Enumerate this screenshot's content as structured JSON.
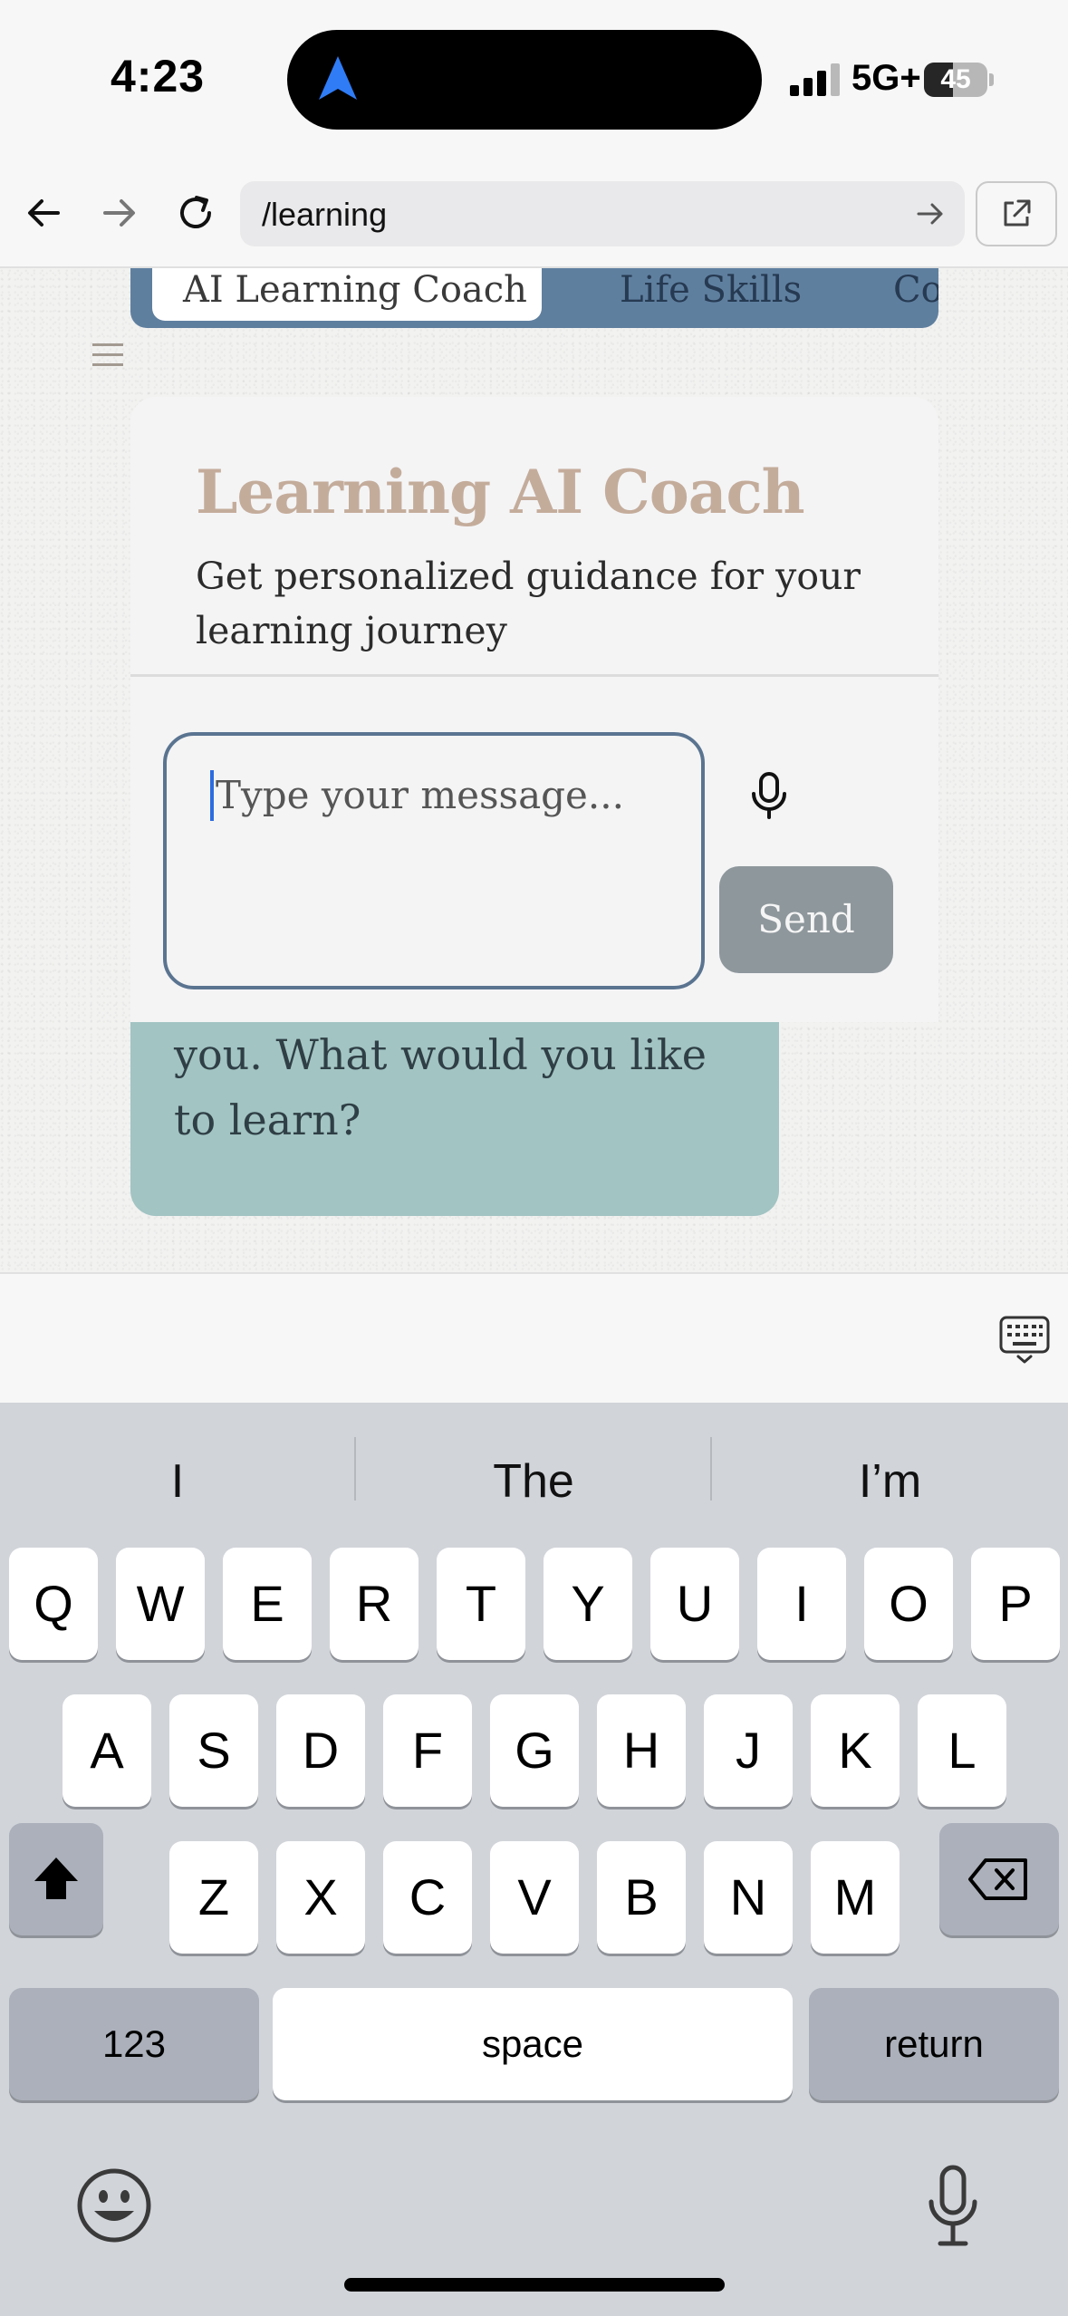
{
  "status_bar": {
    "time": "4:23",
    "network": "5G+",
    "battery": "45",
    "battery_level_percent": 45
  },
  "browser": {
    "url": "/learning",
    "icons": {
      "back": "back-arrow-icon",
      "forward": "forward-arrow-icon",
      "reload": "reload-icon",
      "go": "go-arrow-icon",
      "open_external": "open-external-icon"
    }
  },
  "page": {
    "tabs": [
      {
        "label": "AI Learning Coach",
        "selected": true
      },
      {
        "label": "Life Skills",
        "selected": false
      },
      {
        "label": "Co",
        "selected": false
      }
    ],
    "coach": {
      "title": "Learning AI Coach",
      "subtitle": "Get personalized guidance for your learning journey",
      "input_placeholder": "Type your message...",
      "send_label": "Send"
    },
    "chat_bubble_text": "you. What would you like to learn?",
    "colors": {
      "tab_strip": "#5f7f9f",
      "title": "#c4ac9b",
      "send_button": "#8e979c",
      "bubble": "#a2c4c3",
      "input_border": "#5a7490"
    }
  },
  "keyboard": {
    "suggestions": [
      "I",
      "The",
      "I’m"
    ],
    "row1": [
      "Q",
      "W",
      "E",
      "R",
      "T",
      "Y",
      "U",
      "I",
      "O",
      "P"
    ],
    "row2": [
      "A",
      "S",
      "D",
      "F",
      "G",
      "H",
      "J",
      "K",
      "L"
    ],
    "row3": [
      "Z",
      "X",
      "C",
      "V",
      "B",
      "N",
      "M"
    ],
    "numbers_label": "123",
    "space_label": "space",
    "return_label": "return"
  }
}
